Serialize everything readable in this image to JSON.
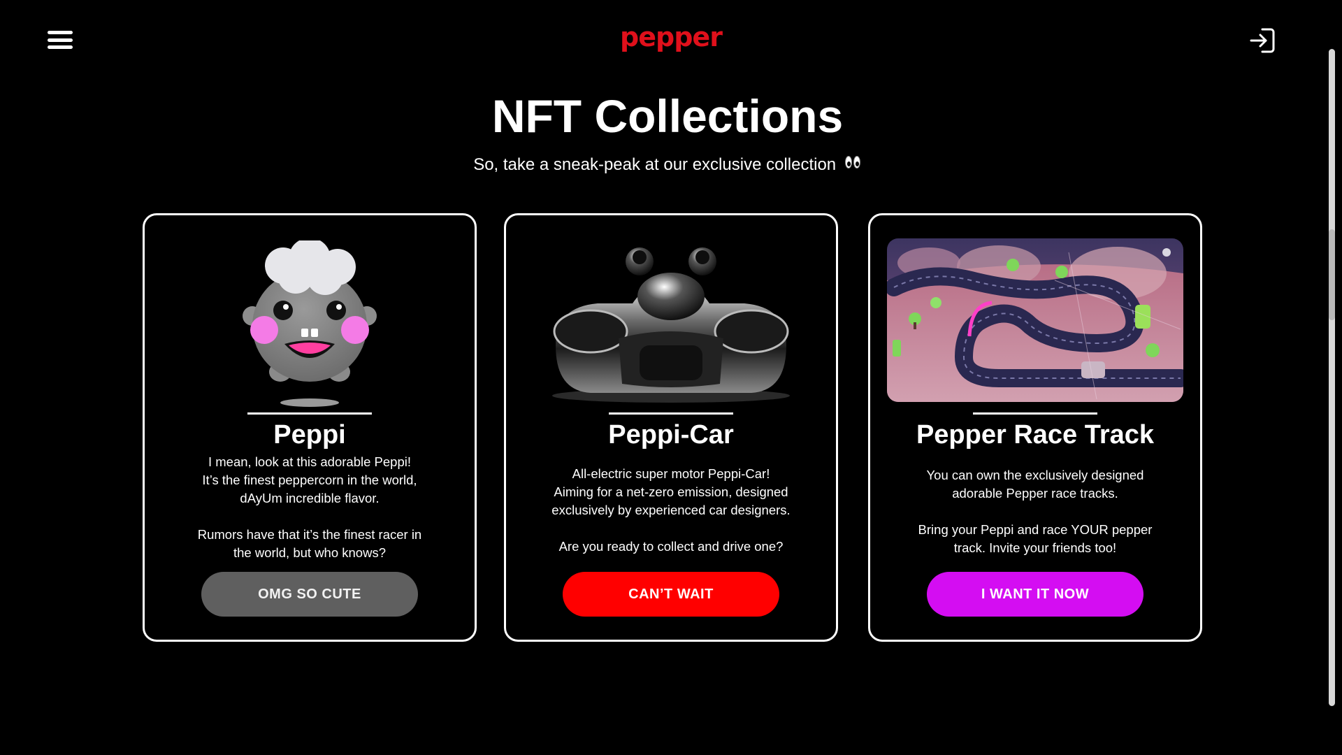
{
  "header": {
    "logo_text": "pepper",
    "menu_icon": "hamburger-menu-icon",
    "login_icon": "login-arrow-icon",
    "logo_color": "#e0101b"
  },
  "hero": {
    "title": "NFT Collections",
    "subtitle": "So, take a sneak-peak at our exclusive collection",
    "subtitle_icon": "eyes-emoji-icon"
  },
  "cards": [
    {
      "title": "Peppi",
      "image": "peppi-character-image",
      "description": "I mean, look at this adorable Peppi!\nIt’s the finest peppercorn in the world,\ndAyUm incredible flavor.\n\nRumors have that it’s the finest racer in\nthe world, but who knows?",
      "button_label": "OMG SO CUTE",
      "button_color": "#5f5f5f"
    },
    {
      "title": "Peppi-Car",
      "image": "peppi-car-image",
      "description": "All-electric super motor Peppi-Car!\nAiming for a net-zero emission, designed\nexclusively by experienced car designers.\n\nAre you ready to collect and drive one?",
      "button_label": "CAN’T WAIT",
      "button_color": "#ff0000"
    },
    {
      "title": "Pepper Race Track",
      "image": "race-track-image",
      "description": "You can own the exclusively designed\nadorable Pepper race tracks.\n\nBring your Peppi and race YOUR pepper\ntrack. Invite your friends too!",
      "button_label": "I WANT IT NOW",
      "button_color": "#d40df2"
    }
  ]
}
